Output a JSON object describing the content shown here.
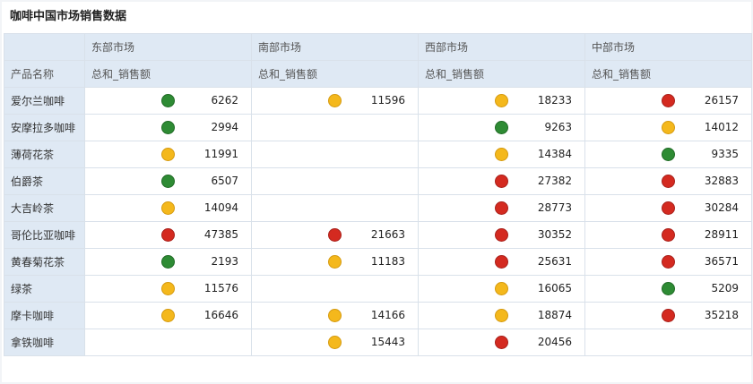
{
  "title": "咖啡中国市场销售数据",
  "header": {
    "product_label": "产品名称",
    "markets": [
      "东部市场",
      "南部市场",
      "西部市场",
      "中部市场"
    ],
    "metric_label": "总和_销售额"
  },
  "colors": {
    "green": "#2e8b34",
    "yellow": "#f4b81c",
    "red": "#d42a20"
  },
  "rows": [
    {
      "name": "爱尔兰咖啡",
      "cells": [
        {
          "status": "green",
          "value": "6262"
        },
        {
          "status": "yellow",
          "value": "11596"
        },
        {
          "status": "yellow",
          "value": "18233"
        },
        {
          "status": "red",
          "value": "26157"
        }
      ]
    },
    {
      "name": "安摩拉多咖啡",
      "cells": [
        {
          "status": "green",
          "value": "2994"
        },
        null,
        {
          "status": "green",
          "value": "9263"
        },
        {
          "status": "yellow",
          "value": "14012"
        }
      ]
    },
    {
      "name": "薄荷花茶",
      "cells": [
        {
          "status": "yellow",
          "value": "11991"
        },
        null,
        {
          "status": "yellow",
          "value": "14384"
        },
        {
          "status": "green",
          "value": "9335"
        }
      ]
    },
    {
      "name": "伯爵茶",
      "cells": [
        {
          "status": "green",
          "value": "6507"
        },
        null,
        {
          "status": "red",
          "value": "27382"
        },
        {
          "status": "red",
          "value": "32883"
        }
      ]
    },
    {
      "name": "大吉岭茶",
      "cells": [
        {
          "status": "yellow",
          "value": "14094"
        },
        null,
        {
          "status": "red",
          "value": "28773"
        },
        {
          "status": "red",
          "value": "30284"
        }
      ]
    },
    {
      "name": "哥伦比亚咖啡",
      "cells": [
        {
          "status": "red",
          "value": "47385"
        },
        {
          "status": "red",
          "value": "21663"
        },
        {
          "status": "red",
          "value": "30352"
        },
        {
          "status": "red",
          "value": "28911"
        }
      ]
    },
    {
      "name": "黄春菊花茶",
      "cells": [
        {
          "status": "green",
          "value": "2193"
        },
        {
          "status": "yellow",
          "value": "11183"
        },
        {
          "status": "red",
          "value": "25631"
        },
        {
          "status": "red",
          "value": "36571"
        }
      ]
    },
    {
      "name": "绿茶",
      "cells": [
        {
          "status": "yellow",
          "value": "11576"
        },
        null,
        {
          "status": "yellow",
          "value": "16065"
        },
        {
          "status": "green",
          "value": "5209"
        }
      ]
    },
    {
      "name": "摩卡咖啡",
      "cells": [
        {
          "status": "yellow",
          "value": "16646"
        },
        {
          "status": "yellow",
          "value": "14166"
        },
        {
          "status": "yellow",
          "value": "18874"
        },
        {
          "status": "red",
          "value": "35218"
        }
      ]
    },
    {
      "name": "拿铁咖啡",
      "cells": [
        null,
        {
          "status": "yellow",
          "value": "15443"
        },
        {
          "status": "red",
          "value": "20456"
        },
        null
      ]
    }
  ]
}
